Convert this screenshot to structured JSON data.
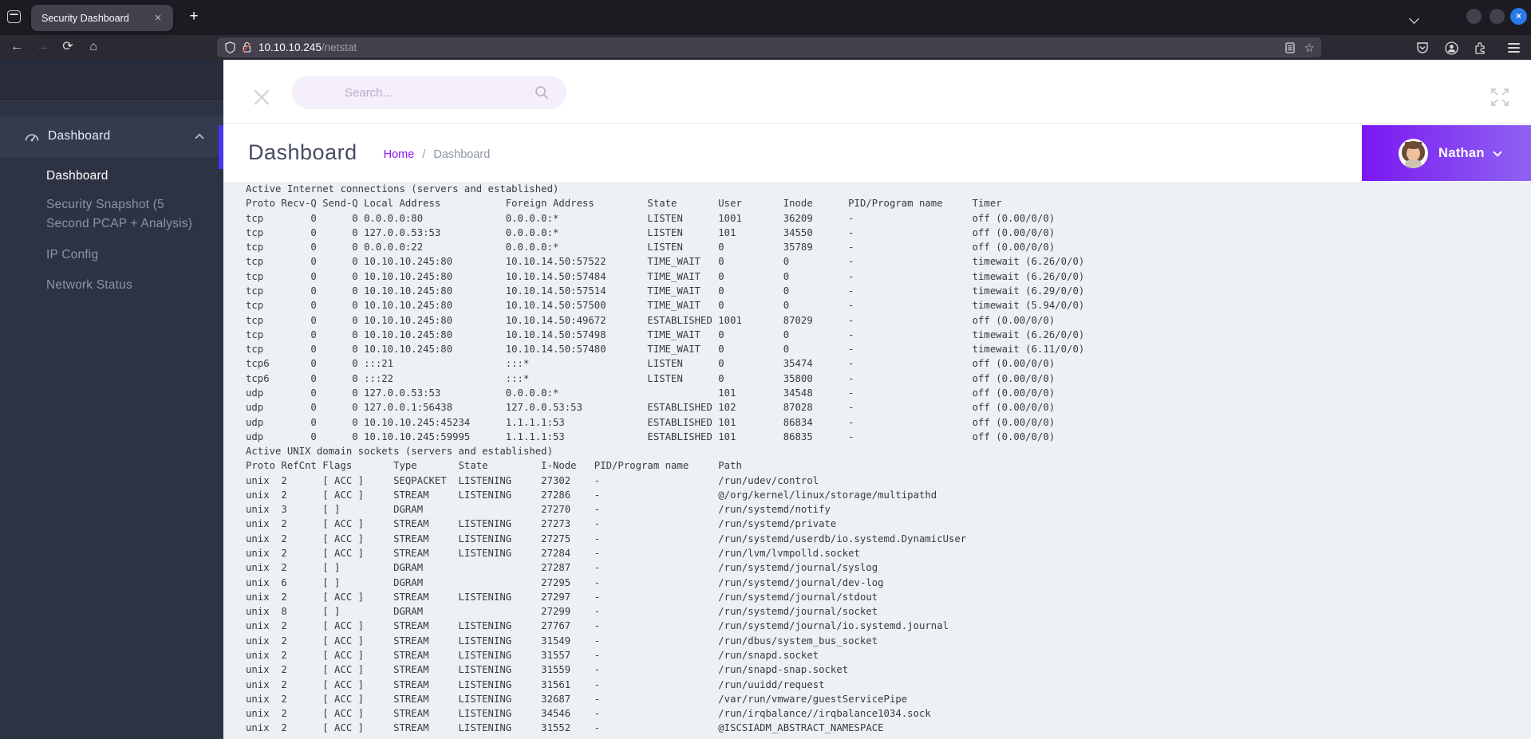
{
  "browser": {
    "tab_title": "Security Dashboard",
    "tab_close": "×",
    "new_tab": "+",
    "url_host": "10.10.10.245",
    "url_path": "/netstat",
    "bookmark_star": "☆",
    "back_arrow": "←",
    "forward_arrow": "→",
    "reload_glyph": "⟳",
    "home_glyph": "⌂"
  },
  "sidebar": {
    "section": {
      "label": "Dashboard",
      "icon": "gauge-icon"
    },
    "items": [
      {
        "label": "Dashboard",
        "active": true
      },
      {
        "label": "Security Snapshot (5\nSecond PCAP + Analysis)",
        "active": false
      },
      {
        "label": "IP Config",
        "active": false
      },
      {
        "label": "Network Status",
        "active": false
      }
    ]
  },
  "topbar": {
    "search_placeholder": "Search..."
  },
  "header": {
    "title": "Dashboard",
    "breadcrumb": {
      "home": "Home",
      "separator": "/",
      "current": "Dashboard"
    }
  },
  "user": {
    "name": "Nathan"
  },
  "colors": {
    "accent_bar": "#4636f0",
    "breadcrumb_link": "#8a18f0",
    "badge_gradient_start": "#7a18f2",
    "badge_gradient_end": "#8e63f3",
    "sidebar_bg": "#2e3344",
    "content_bg": "#edf1f5",
    "close_window_button": "#2979e8"
  },
  "netstat": {
    "lines": [
      "Active Internet connections (servers and established)",
      "Proto Recv-Q Send-Q Local Address           Foreign Address         State       User       Inode      PID/Program name     Timer",
      "tcp        0      0 0.0.0.0:80              0.0.0.0:*               LISTEN      1001       36209      -                    off (0.00/0/0)",
      "tcp        0      0 127.0.0.53:53           0.0.0.0:*               LISTEN      101        34550      -                    off (0.00/0/0)",
      "tcp        0      0 0.0.0.0:22              0.0.0.0:*               LISTEN      0          35789      -                    off (0.00/0/0)",
      "tcp        0      0 10.10.10.245:80         10.10.14.50:57522       TIME_WAIT   0          0          -                    timewait (6.26/0/0)",
      "tcp        0      0 10.10.10.245:80         10.10.14.50:57484       TIME_WAIT   0          0          -                    timewait (6.26/0/0)",
      "tcp        0      0 10.10.10.245:80         10.10.14.50:57514       TIME_WAIT   0          0          -                    timewait (6.29/0/0)",
      "tcp        0      0 10.10.10.245:80         10.10.14.50:57500       TIME_WAIT   0          0          -                    timewait (5.94/0/0)",
      "tcp        0      0 10.10.10.245:80         10.10.14.50:49672       ESTABLISHED 1001       87029      -                    off (0.00/0/0)",
      "tcp        0      0 10.10.10.245:80         10.10.14.50:57498       TIME_WAIT   0          0          -                    timewait (6.26/0/0)",
      "tcp        0      0 10.10.10.245:80         10.10.14.50:57480       TIME_WAIT   0          0          -                    timewait (6.11/0/0)",
      "tcp6       0      0 :::21                   :::*                    LISTEN      0          35474      -                    off (0.00/0/0)",
      "tcp6       0      0 :::22                   :::*                    LISTEN      0          35800      -                    off (0.00/0/0)",
      "udp        0      0 127.0.0.53:53           0.0.0.0:*                           101        34548      -                    off (0.00/0/0)",
      "udp        0      0 127.0.0.1:56438         127.0.0.53:53           ESTABLISHED 102        87028      -                    off (0.00/0/0)",
      "udp        0      0 10.10.10.245:45234      1.1.1.1:53              ESTABLISHED 101        86834      -                    off (0.00/0/0)",
      "udp        0      0 10.10.10.245:59995      1.1.1.1:53              ESTABLISHED 101        86835      -                    off (0.00/0/0)",
      "Active UNIX domain sockets (servers and established)",
      "Proto RefCnt Flags       Type       State         I-Node   PID/Program name     Path",
      "unix  2      [ ACC ]     SEQPACKET  LISTENING     27302    -                    /run/udev/control",
      "unix  2      [ ACC ]     STREAM     LISTENING     27286    -                    @/org/kernel/linux/storage/multipathd",
      "unix  3      [ ]         DGRAM                    27270    -                    /run/systemd/notify",
      "unix  2      [ ACC ]     STREAM     LISTENING     27273    -                    /run/systemd/private",
      "unix  2      [ ACC ]     STREAM     LISTENING     27275    -                    /run/systemd/userdb/io.systemd.DynamicUser",
      "unix  2      [ ACC ]     STREAM     LISTENING     27284    -                    /run/lvm/lvmpolld.socket",
      "unix  2      [ ]         DGRAM                    27287    -                    /run/systemd/journal/syslog",
      "unix  6      [ ]         DGRAM                    27295    -                    /run/systemd/journal/dev-log",
      "unix  2      [ ACC ]     STREAM     LISTENING     27297    -                    /run/systemd/journal/stdout",
      "unix  8      [ ]         DGRAM                    27299    -                    /run/systemd/journal/socket",
      "unix  2      [ ACC ]     STREAM     LISTENING     27767    -                    /run/systemd/journal/io.systemd.journal",
      "unix  2      [ ACC ]     STREAM     LISTENING     31549    -                    /run/dbus/system_bus_socket",
      "unix  2      [ ACC ]     STREAM     LISTENING     31557    -                    /run/snapd.socket",
      "unix  2      [ ACC ]     STREAM     LISTENING     31559    -                    /run/snapd-snap.socket",
      "unix  2      [ ACC ]     STREAM     LISTENING     31561    -                    /run/uuidd/request",
      "unix  2      [ ACC ]     STREAM     LISTENING     32687    -                    /var/run/vmware/guestServicePipe",
      "unix  2      [ ACC ]     STREAM     LISTENING     34546    -                    /run/irqbalance//irqbalance1034.sock",
      "unix  2      [ ACC ]     STREAM     LISTENING     31552    -                    @ISCSIADM_ABSTRACT_NAMESPACE"
    ]
  }
}
